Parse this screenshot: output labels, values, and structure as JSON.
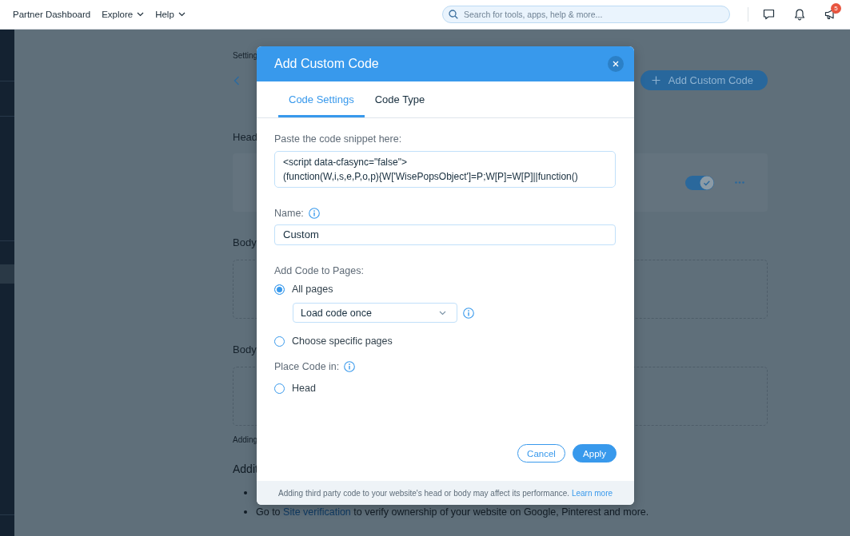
{
  "top_bar": {
    "title": "Partner Dashboard",
    "menus": [
      {
        "label": "Explore"
      },
      {
        "label": "Help"
      }
    ],
    "search": {
      "placeholder": "Search for tools, apps, help & more..."
    },
    "notification_count": "5"
  },
  "sidebar": {
    "items": [
      {
        "selected": false
      },
      {
        "selected": false
      },
      {
        "selected": false
      },
      {
        "selected": true
      },
      {
        "selected": false
      }
    ]
  },
  "background_page": {
    "breadcrumb": "Setting",
    "add_button": "Add Custom Code",
    "sections": [
      {
        "kind": "card",
        "label": "Head",
        "toggle_on": true
      },
      {
        "kind": "dashed",
        "label": "Body"
      },
      {
        "kind": "dashed",
        "label": "Body"
      }
    ],
    "note": "Adding",
    "additional_heading": "Addit",
    "bullets": [
      {
        "kind": "covered"
      },
      {
        "kind": "text",
        "before": "Go to ",
        "link": "Site verification",
        "after": " to verify ownership of your website on Google, Pinterest and more."
      }
    ]
  },
  "dialog": {
    "title": "Add Custom Code",
    "tabs": [
      {
        "label": "Code Settings",
        "selected": true
      },
      {
        "label": "Code Type",
        "selected": false
      }
    ],
    "snippet": {
      "label": "Paste the code snippet here:",
      "lines": [
        "<script data-cfasync=\"false\">",
        "(function(W,i,s,e,P,o,p){W['WisePopsObject']=P;W[P]=W[P]||function()"
      ]
    },
    "name": {
      "label": "Name:",
      "value": "Custom"
    },
    "pages": {
      "label": "Add Code to Pages:",
      "options": [
        {
          "label": "All pages",
          "selected": true
        },
        {
          "label": "Choose specific pages",
          "selected": false
        }
      ],
      "load_mode": "Load code once"
    },
    "placement": {
      "label": "Place Code in:",
      "options": [
        {
          "label": "Head",
          "selected": false
        }
      ]
    },
    "buttons": [
      {
        "label": "Cancel",
        "kind": "secondary"
      },
      {
        "label": "Apply",
        "kind": "primary"
      }
    ],
    "footer": {
      "text": "Adding third party code to your website's head or body may affect its performance.",
      "link": "Learn more"
    }
  }
}
